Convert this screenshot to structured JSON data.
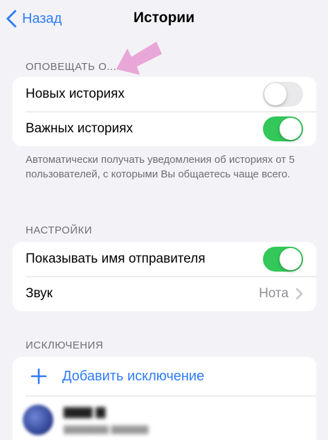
{
  "nav": {
    "back_label": "Назад",
    "title": "Истории"
  },
  "notify": {
    "header": "ОПОВЕЩАТЬ О...",
    "rows": [
      {
        "label": "Новых историях",
        "enabled": false
      },
      {
        "label": "Важных историях",
        "enabled": true
      }
    ],
    "footer": "Автоматически получать уведомления об историях от 5 пользователей, с которыми Вы общаетесь чаще всего."
  },
  "settings": {
    "header": "НАСТРОЙКИ",
    "show_sender_label": "Показывать имя отправителя",
    "show_sender_enabled": true,
    "sound_label": "Звук",
    "sound_value": "Нота"
  },
  "exceptions": {
    "header": "ИСКЛЮЧЕНИЯ",
    "add_label": "Добавить исключение"
  },
  "colors": {
    "accent": "#2f7cf6",
    "toggle_on": "#34c759",
    "arrow": "#e9a7d8"
  },
  "icons": [
    "chevron-left-icon",
    "plus-icon",
    "chevron-right-icon",
    "arrow-icon"
  ]
}
